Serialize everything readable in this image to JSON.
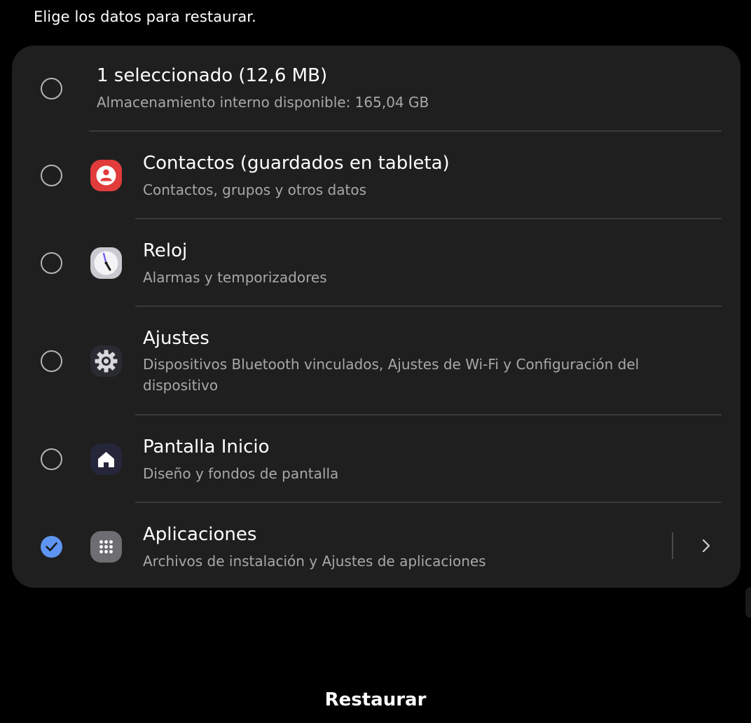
{
  "header": {
    "instruction": "Elige los datos para restaurar."
  },
  "summary": {
    "title": "1 seleccionado (12,6 MB)",
    "subtitle": "Almacenamiento interno disponible: 165,04 GB",
    "checked": false
  },
  "items": [
    {
      "title": "Contactos (guardados en tableta)",
      "subtitle": "Contactos, grupos y otros datos",
      "icon": "contacts-icon",
      "checked": false
    },
    {
      "title": "Reloj",
      "subtitle": "Alarmas y temporizadores",
      "icon": "clock-icon",
      "checked": false
    },
    {
      "title": "Ajustes",
      "subtitle": "Dispositivos Bluetooth vinculados, Ajustes de Wi-Fi y Configuración del dispositivo",
      "icon": "settings-gear-icon",
      "checked": false
    },
    {
      "title": "Pantalla Inicio",
      "subtitle": "Diseño y fondos de pantalla",
      "icon": "home-icon",
      "checked": false
    },
    {
      "title": "Aplicaciones",
      "subtitle": "Archivos de instalación y Ajustes de aplicaciones",
      "icon": "apps-grid-icon",
      "checked": true
    }
  ],
  "footer": {
    "restore_label": "Restaurar"
  },
  "colors": {
    "background": "#000000",
    "card": "#1f1f1f",
    "accent": "#5e95f2",
    "contacts_red": "#e23b3b"
  }
}
